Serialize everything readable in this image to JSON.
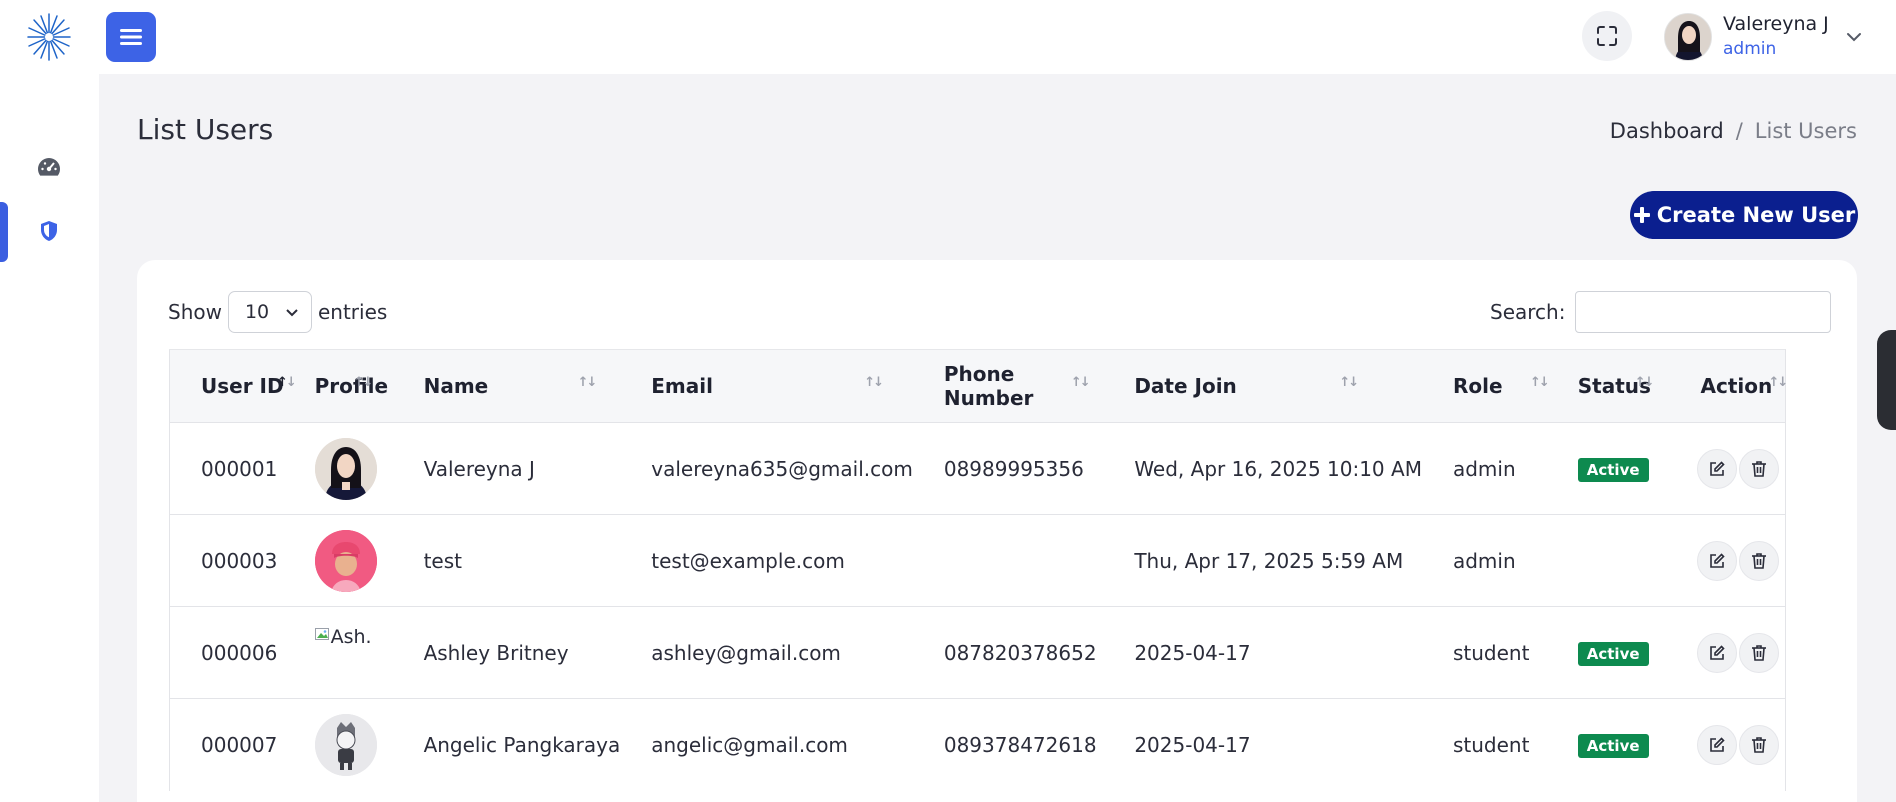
{
  "header": {
    "user_name": "Valereyna J",
    "user_role": "admin"
  },
  "page": {
    "title": "List Users",
    "breadcrumb": {
      "home": "Dashboard",
      "separator": "/",
      "current": "List Users"
    },
    "create_button_label": "Create New User"
  },
  "table_controls": {
    "show_label": "Show",
    "entries_value": "10",
    "entries_label": "entries",
    "search_label": "Search:",
    "search_value": ""
  },
  "table": {
    "columns": [
      "User ID",
      "Profile",
      "Name",
      "Email",
      "Phone Number",
      "Date Join",
      "Role",
      "Status",
      "Action"
    ],
    "rows": [
      {
        "user_id": "000001",
        "profile": "avatar-photo",
        "name": "Valereyna J",
        "email": "valereyna635@gmail.com",
        "phone": "08989995356",
        "date_join": "Wed, Apr 16, 2025 10:10 AM",
        "role": "admin",
        "status": "Active"
      },
      {
        "user_id": "000003",
        "profile": "avatar-3d-character",
        "name": "test",
        "email": "test@example.com",
        "phone": "",
        "date_join": "Thu, Apr 17, 2025 5:59 AM",
        "role": "admin",
        "status": ""
      },
      {
        "user_id": "000006",
        "profile_alt": "Ash.",
        "name": "Ashley Britney",
        "email": "ashley@gmail.com",
        "phone": "087820378652",
        "date_join": "2025-04-17",
        "role": "student",
        "status": "Active"
      },
      {
        "user_id": "000007",
        "profile": "avatar-cartoon",
        "name": "Angelic Pangkaraya",
        "email": "angelic@gmail.com",
        "phone": "089378472618",
        "date_join": "2025-04-17",
        "role": "student",
        "status": "Active"
      }
    ]
  },
  "colors": {
    "primary": "#3d63e6",
    "create_button": "#0b1f8f",
    "status_active": "#0d8a4f"
  },
  "icons": [
    "logo-burst-icon",
    "dashboard-gauge-icon",
    "shield-icon",
    "menu-icon",
    "fullscreen-icon",
    "chevron-down-icon",
    "plus-icon",
    "sort-icon",
    "edit-icon",
    "trash-icon"
  ]
}
